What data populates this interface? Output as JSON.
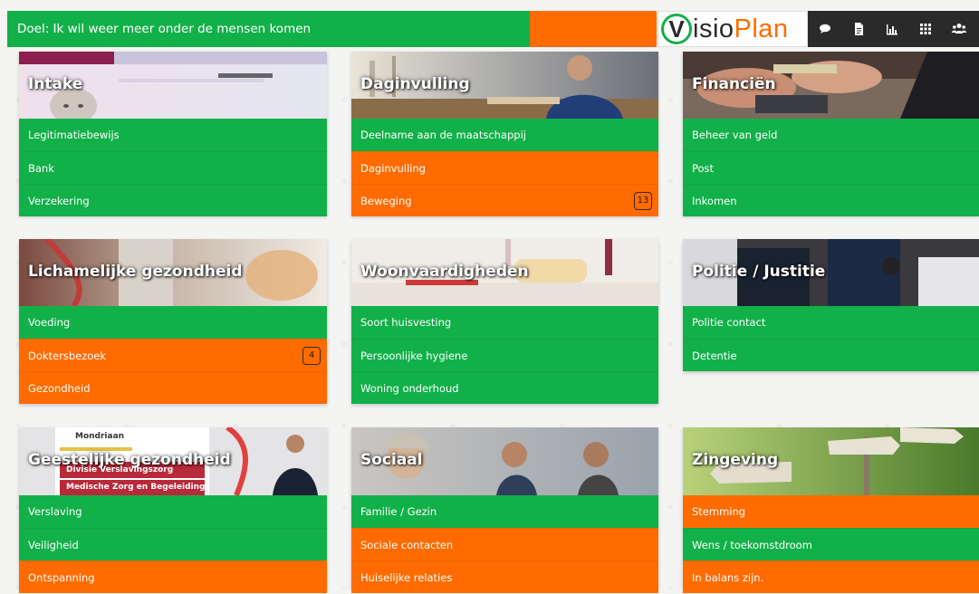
{
  "header": {
    "goal": "Doel: Ik wil weer meer onder de mensen komen",
    "logo": {
      "v": "V",
      "text_a": "isio",
      "text_b": "Plan"
    },
    "icons": [
      "chat-icon",
      "document-icon",
      "bar-chart-icon",
      "grid-icon",
      "users-icon"
    ]
  },
  "colors": {
    "green": "#12b049",
    "orange": "#ff6b00",
    "dark": "#2a2a2a"
  },
  "categories": [
    {
      "title": "Intake",
      "image": "passport-photo",
      "items": [
        {
          "label": "Legitimatiebewijs",
          "color": "green"
        },
        {
          "label": "Bank",
          "color": "green"
        },
        {
          "label": "Verzekering",
          "color": "green"
        }
      ]
    },
    {
      "title": "Daginvulling",
      "image": "worker-photo",
      "items": [
        {
          "label": "Deelname aan de maatschappij",
          "color": "green"
        },
        {
          "label": "Daginvulling",
          "color": "orange"
        },
        {
          "label": "Beweging",
          "color": "orange",
          "badge": "13"
        }
      ]
    },
    {
      "title": "Financiën",
      "image": "money-photo",
      "items": [
        {
          "label": "Beheer van geld",
          "color": "green"
        },
        {
          "label": "Post",
          "color": "green"
        },
        {
          "label": "Inkomen",
          "color": "green"
        }
      ]
    },
    {
      "title": "Lichamelijke gezondheid",
      "image": "doctor-photo",
      "items": [
        {
          "label": "Voeding",
          "color": "green"
        },
        {
          "label": "Doktersbezoek",
          "color": "orange",
          "badge": "4"
        },
        {
          "label": "Gezondheid",
          "color": "orange"
        }
      ]
    },
    {
      "title": "Woonvaardigheden",
      "image": "bathroom-photo",
      "items": [
        {
          "label": "Soort huisvesting",
          "color": "green"
        },
        {
          "label": "Persoonlijke hygiene",
          "color": "green"
        },
        {
          "label": "Woning onderhoud",
          "color": "green"
        }
      ]
    },
    {
      "title": "Politie / Justitie",
      "image": "police-photo",
      "items": [
        {
          "label": "Politie contact",
          "color": "green"
        },
        {
          "label": "Detentie",
          "color": "green"
        }
      ]
    },
    {
      "title": "Geestelijke gezondheid",
      "image": "clinic-photo",
      "sign": {
        "line1": "Mondriaan",
        "line2": "Divisie Verslavingszorg",
        "line3": "Medische Zorg en Begeleiding"
      },
      "items": [
        {
          "label": "Verslaving",
          "color": "green"
        },
        {
          "label": "Veiligheid",
          "color": "green"
        },
        {
          "label": "Ontspanning",
          "color": "orange"
        }
      ]
    },
    {
      "title": "Sociaal",
      "image": "people-photo",
      "items": [
        {
          "label": "Familie / Gezin",
          "color": "green"
        },
        {
          "label": "Sociale contacten",
          "color": "orange"
        },
        {
          "label": "Huiselijke relaties",
          "color": "orange"
        }
      ]
    },
    {
      "title": "Zingeving",
      "image": "signpost-photo",
      "items": [
        {
          "label": "Stemming",
          "color": "orange"
        },
        {
          "label": "Wens / toekomstdroom",
          "color": "green"
        },
        {
          "label": "In balans zijn.",
          "color": "orange"
        }
      ]
    }
  ]
}
